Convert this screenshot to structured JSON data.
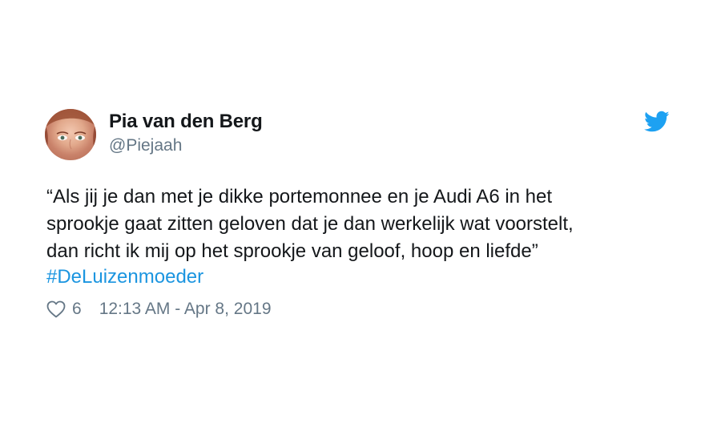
{
  "author": {
    "name": "Pia van den Berg",
    "handle": "@Piejaah",
    "avatar_icon": "profile-photo"
  },
  "brand": {
    "logo_icon": "twitter-bird-icon",
    "color": "#1da1f2"
  },
  "tweet": {
    "lines": [
      "“Als jij je dan met je dikke portemonnee en je Audi A6 in het",
      "sprookje gaat zitten geloven dat je dan werkelijk wat voorstelt,",
      "dan richt ik mij op het sprookje van geloof, hoop en liefde”"
    ],
    "hashtag": "#DeLuizenmoeder",
    "hashtag_color": "#1b95e0"
  },
  "meta": {
    "like_icon": "heart-outline-icon",
    "likes": "6",
    "timestamp": "12:13 AM - Apr 8, 2019"
  }
}
